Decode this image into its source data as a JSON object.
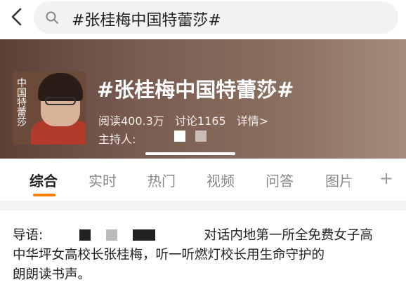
{
  "search": {
    "query": "#张桂梅中国特蕾莎#"
  },
  "topic": {
    "title": "#张桂梅中国特蕾莎#",
    "reads": "阅读400.3万",
    "discussions": "讨论1165",
    "details": "详情>",
    "host_label": "主持人:",
    "cover_text": "中国特蕾莎"
  },
  "tabs": [
    "综合",
    "实时",
    "热门",
    "视频",
    "问答",
    "图片"
  ],
  "tab_plus": "+",
  "intro": {
    "label": "导语:",
    "line1_tail": "对话内地第一所全免费女子高",
    "line2": "中华坪女高校长张桂梅，听一听燃灯校长用生命守护的",
    "line3": "朗朗读书声。"
  },
  "colors": {
    "accent": "#ff8200"
  }
}
